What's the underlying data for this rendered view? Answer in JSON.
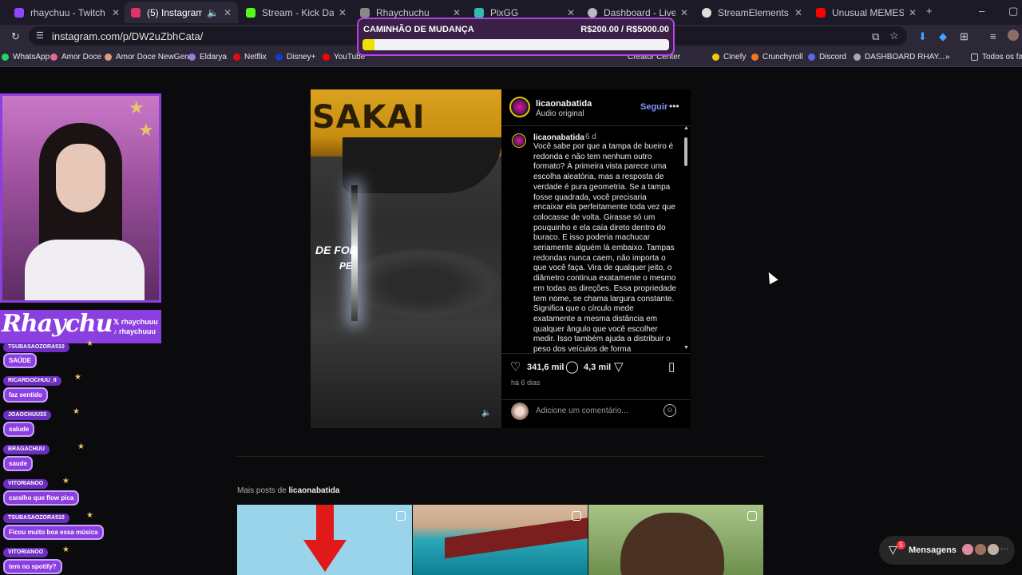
{
  "browser": {
    "tabs": [
      {
        "title": "rhaychuu - Twitch",
        "color": "#9146ff"
      },
      {
        "title": "(5) Instagram",
        "color": "#e1306c"
      },
      {
        "title": "Stream - Kick Dashboard",
        "color": "#53fc18"
      },
      {
        "title": "Rhaychuchu",
        "color": "#888888"
      },
      {
        "title": "PixGG",
        "color": "#32bcad"
      },
      {
        "title": "Dashboard - LivePix",
        "color": "#bbbbbb"
      },
      {
        "title": "StreamElements - Activit",
        "color": "#dddddd"
      },
      {
        "title": "Unusual MEMES são ES",
        "color": "#ff0000"
      }
    ],
    "url": "instagram.com/p/DW2uZbhCata/",
    "bookmarks": [
      "WhatsApp",
      "Amor Doce",
      "Amor Doce NewGen",
      "Eldarya",
      "Netflix",
      "Disney+",
      "YouTube",
      "Creator Center",
      "Cinefy",
      "Crunchyroll",
      "Discord",
      "DASHBOARD RHAY...",
      "Todos os fav"
    ]
  },
  "goal": {
    "title": "CAMINHÃO DE MUDANÇA",
    "amount": "R$200.00 / R$5000.00",
    "progress": 0.04,
    "bar_color": "#f0e000",
    "border_color": "#b443e8"
  },
  "post": {
    "media_caption_line1": "DE FOR",
    "media_caption_line2": "PE",
    "machine_text": "SAKAI",
    "username": "licaonabatida",
    "audio": "Áudio original",
    "follow": "Seguir",
    "age_short": "6 d",
    "body": "Você sabe por que a tampa de bueiro é redonda e não tem nenhum outro formato? À primeira vista parece uma escolha aleatória, mas a resposta de verdade é pura geometria. Se a tampa fosse quadrada, você precisaria encaixar ela perfeitamente toda vez que colocasse de volta. Girasse só um pouquinho e ela caía direto dentro do buraco. E isso poderia machucar seriamente alguém lá embaixo. Tampas redondas nunca caem, não importa o que você faça. Vira de qualquer jeito, o diâmetro continua exatamente o mesmo em todas as direções. Essa propriedade tem nome, se chama largura constante. Significa que o círculo mede exatamente a mesma distância em qualquer ângulo que você escolher medir. Isso também ajuda a distribuir o peso dos veículos de forma",
    "likes": "341,6 mil",
    "comments": "4,3 mil",
    "posted": "há 6 dias",
    "comment_placeholder": "Adicione um comentário...",
    "link_color": "#7f97ff"
  },
  "more_posts": {
    "label": "Mais posts de",
    "user": "licaonabatida"
  },
  "messages": {
    "label": "Mensagens",
    "badge": "5"
  },
  "stream": {
    "brand": "Rhaychu",
    "handles": [
      "rhaychuuu",
      "rhaychuuu"
    ],
    "accent": "#8c3fe0",
    "chat": [
      {
        "user": "TSUBASAOZORA510",
        "msg": "SAÚDE"
      },
      {
        "user": "RICARDOCHUU_II",
        "msg": "faz sentido"
      },
      {
        "user": "JOAOCHUU33",
        "msg": "salude"
      },
      {
        "user": "BRAGACHUU",
        "msg": "saude"
      },
      {
        "user": "VITORIANOO",
        "msg": "caralho que flow pica"
      },
      {
        "user": "TSUBASAOZORA510",
        "msg": "Ficou muito boa essa música"
      },
      {
        "user": "VITORIANOO",
        "msg": "tem no spotify?"
      }
    ]
  }
}
